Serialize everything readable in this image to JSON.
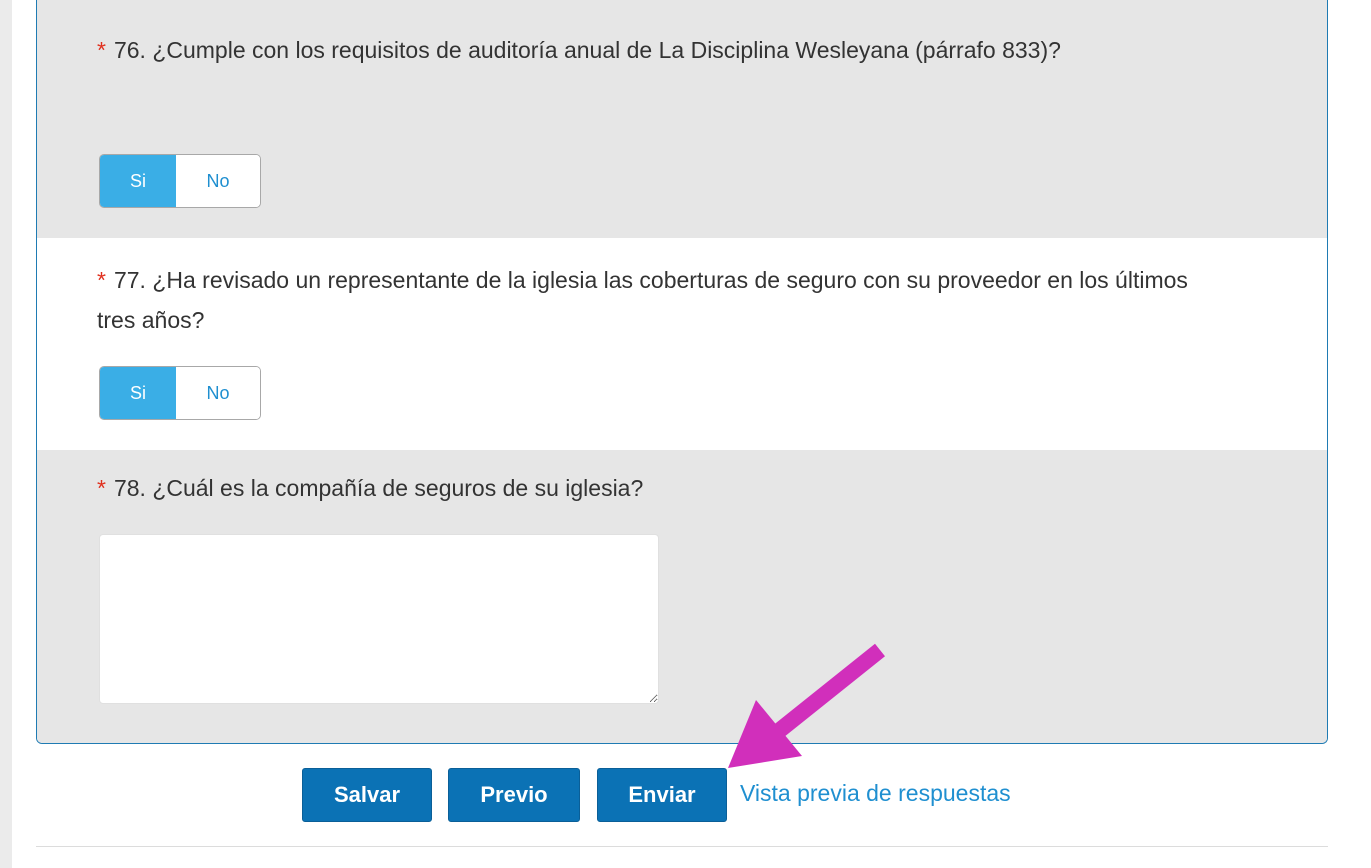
{
  "questions": [
    {
      "required_mark": "*",
      "text": "76. ¿Cumple con los requisitos de auditoría anual de La Disciplina Wesleyana (párrafo 833)?",
      "options": [
        "Si",
        "No"
      ],
      "selected": "Si"
    },
    {
      "required_mark": "*",
      "text": "77. ¿Ha revisado un representante de la iglesia las coberturas de seguro con su proveedor en los últimos tres años?",
      "options": [
        "Si",
        "No"
      ],
      "selected": "Si"
    },
    {
      "required_mark": "*",
      "text": "78. ¿Cuál es la compañía de seguros de su iglesia?",
      "answer_value": ""
    }
  ],
  "actions": {
    "save_label": "Salvar",
    "previous_label": "Previo",
    "submit_label": "Enviar",
    "preview_link_label": "Vista previa de respuestas"
  },
  "colors": {
    "toggle_selected": "#3aaee6",
    "button_primary": "#0b72b5",
    "link": "#1f8fd0",
    "required": "#e0301e",
    "annotation_arrow": "#d12fbb",
    "question_alt_bg": "#e6e6e6"
  }
}
